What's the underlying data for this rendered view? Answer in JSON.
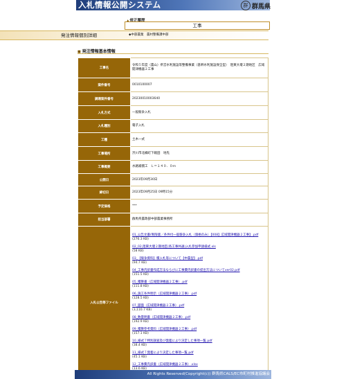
{
  "header": {
    "system_title": "入札情報公開システム",
    "prefecture": "群馬県",
    "seal_glyph": "群"
  },
  "revision": {
    "label": "修正履歴",
    "value": "工事"
  },
  "page": {
    "title": "発注情報個別詳細",
    "breadcrumb": "◆中部農業　農村整備課中部"
  },
  "section": {
    "title": "発注情報基本情報"
  },
  "fields": [
    {
      "label": "工事名",
      "value": "令和５年度（農山）県営水利施設等整備事業（基幹水利施設保全型）　阻東大堰２期地区　広域開津機器２工事"
    },
    {
      "label": "案件番号",
      "value": "0010100007"
    },
    {
      "label": "調達案件番号",
      "value": "20230010003640"
    },
    {
      "label": "入札方式",
      "value": "一般競争入札"
    },
    {
      "label": "入札種別",
      "value": "電子入札"
    },
    {
      "label": "工種",
      "value": "土木一式"
    },
    {
      "label": "工事場所",
      "value": "渋川市北橘町下箱田　地先"
    },
    {
      "label": "工事概要",
      "value": "水路補償工　Ｌ＝１４０．０ｍ"
    },
    {
      "label": "公開日",
      "value": "2023年09月30日"
    },
    {
      "label": "締切日",
      "value": "2023年09月25日 09時15分"
    },
    {
      "label": "予定価格",
      "value": "***"
    },
    {
      "label": "担当部署",
      "value": "群馬県農政部中部農業事務所"
    }
  ],
  "files_label": "入札公告等ファイル",
  "files": [
    {
      "name": "01_公告文書(制限版／条件付一般競争入札（価格のみ）【008】広域開津機器２工事】.pdf",
      "size": "(276.3 KB)"
    },
    {
      "name": "02_02,阻東大堰２期地区(各工事共通)入札参加申請様式.xls",
      "size": "(58 KB)"
    },
    {
      "name": "03_【競争資料】積入札等について【中農型】.pdf",
      "size": "(94.7 KB)"
    },
    {
      "name": "04_工事内訳書作成方法ならびに工事費内訳書の提出方法についてver02.pdf",
      "size": "(151.5 KB)"
    },
    {
      "name": "05_積算書（広域開津機器２工事）.pdf",
      "size": "(111.8 KB)"
    },
    {
      "name": "06_施工条件明示（広域開津機器２工事）.pdf",
      "size": "(128.5 KB)"
    },
    {
      "name": "07_図面（広域開津機器２工事）.pdf",
      "size": "(3,110.7 KB)"
    },
    {
      "name": "08_数量明書（広域開津機器２工事）.pdf",
      "size": "(192.9 KB)"
    },
    {
      "name": "09_積算参考資料（広域開津機器２工事）.pdf",
      "size": "(157.1 KB)"
    },
    {
      "name": "10_様式７特別調査及び発着により決定した事項一覧.pdf",
      "size": "(38.4 KB)"
    },
    {
      "name": "11_様式７発着により決定した事項一覧.pdf",
      "size": "(45.1 KB)"
    },
    {
      "name": "12_工事費内訳書（広域開津機器２工事）.xlsx",
      "size": "(13.6 KB)"
    }
  ],
  "footer": {
    "copyright": "All Rights Reserved(Copyright(c)) 群馬県CALS/EC市町村推進協議会"
  }
}
